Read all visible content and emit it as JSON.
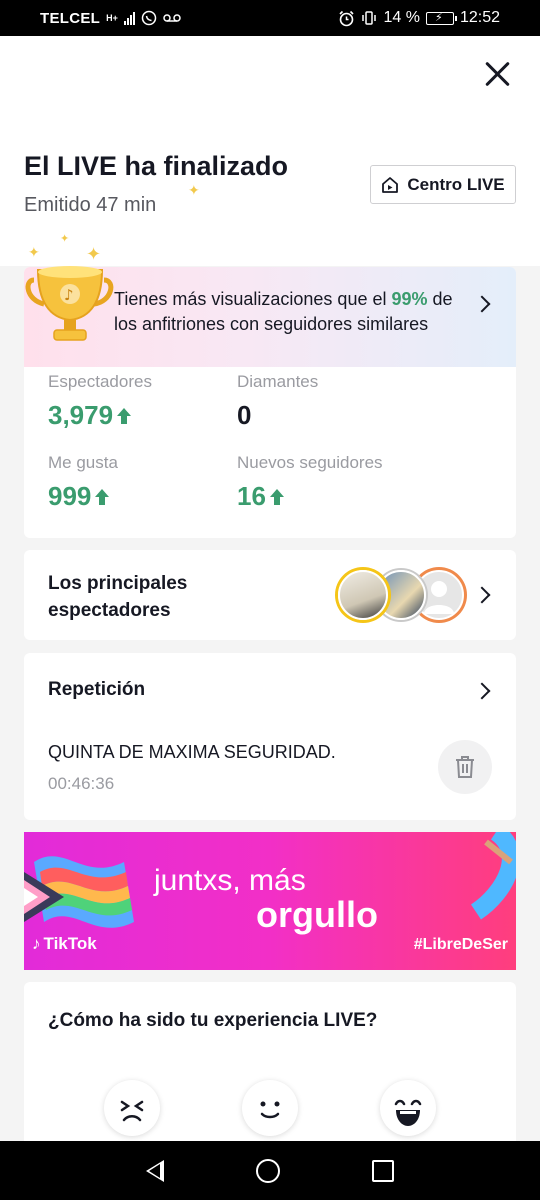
{
  "status_bar": {
    "carrier": "TELCEL",
    "network": "H+",
    "battery": "14 %",
    "time": "12:52"
  },
  "header": {
    "title": "El LIVE ha finalizado",
    "subtitle": "Emitido 47 min",
    "centro_button": "Centro LIVE",
    "close_icon": "close-icon"
  },
  "stats": {
    "banner_prefix": "Tienes más visualizaciones que el ",
    "banner_pct": "99%",
    "banner_suffix": " de los anfitriones con seguidores similares",
    "items": [
      {
        "label": "Espectadores",
        "value": "3,979",
        "trend": "up"
      },
      {
        "label": "Diamantes",
        "value": "0",
        "trend": "none"
      },
      {
        "label": "Me gusta",
        "value": "999",
        "trend": "up"
      },
      {
        "label": "Nuevos seguidores",
        "value": "16",
        "trend": "up"
      }
    ],
    "accent_color": "#3a9c6e"
  },
  "viewers": {
    "label": "Los principales espectadores",
    "avatar_rings": [
      "#f5c518",
      "#c9c9c9",
      "#f08a4b"
    ]
  },
  "replay": {
    "title": "Repetición",
    "name": "QUINTA DE MAXIMA SEGURIDAD.",
    "duration": "00:46:36"
  },
  "promo": {
    "line1": "juntxs, más",
    "line2": "orgullo",
    "brand": "TikTok",
    "hashtag": "#LibreDeSer"
  },
  "experience": {
    "title": "¿Cómo ha sido tu experiencia LIVE?",
    "options": [
      "bad-face-icon",
      "neutral-face-icon",
      "happy-face-icon"
    ]
  },
  "nav_bar": {
    "icons": [
      "back-icon",
      "home-icon",
      "recent-apps-icon"
    ]
  }
}
